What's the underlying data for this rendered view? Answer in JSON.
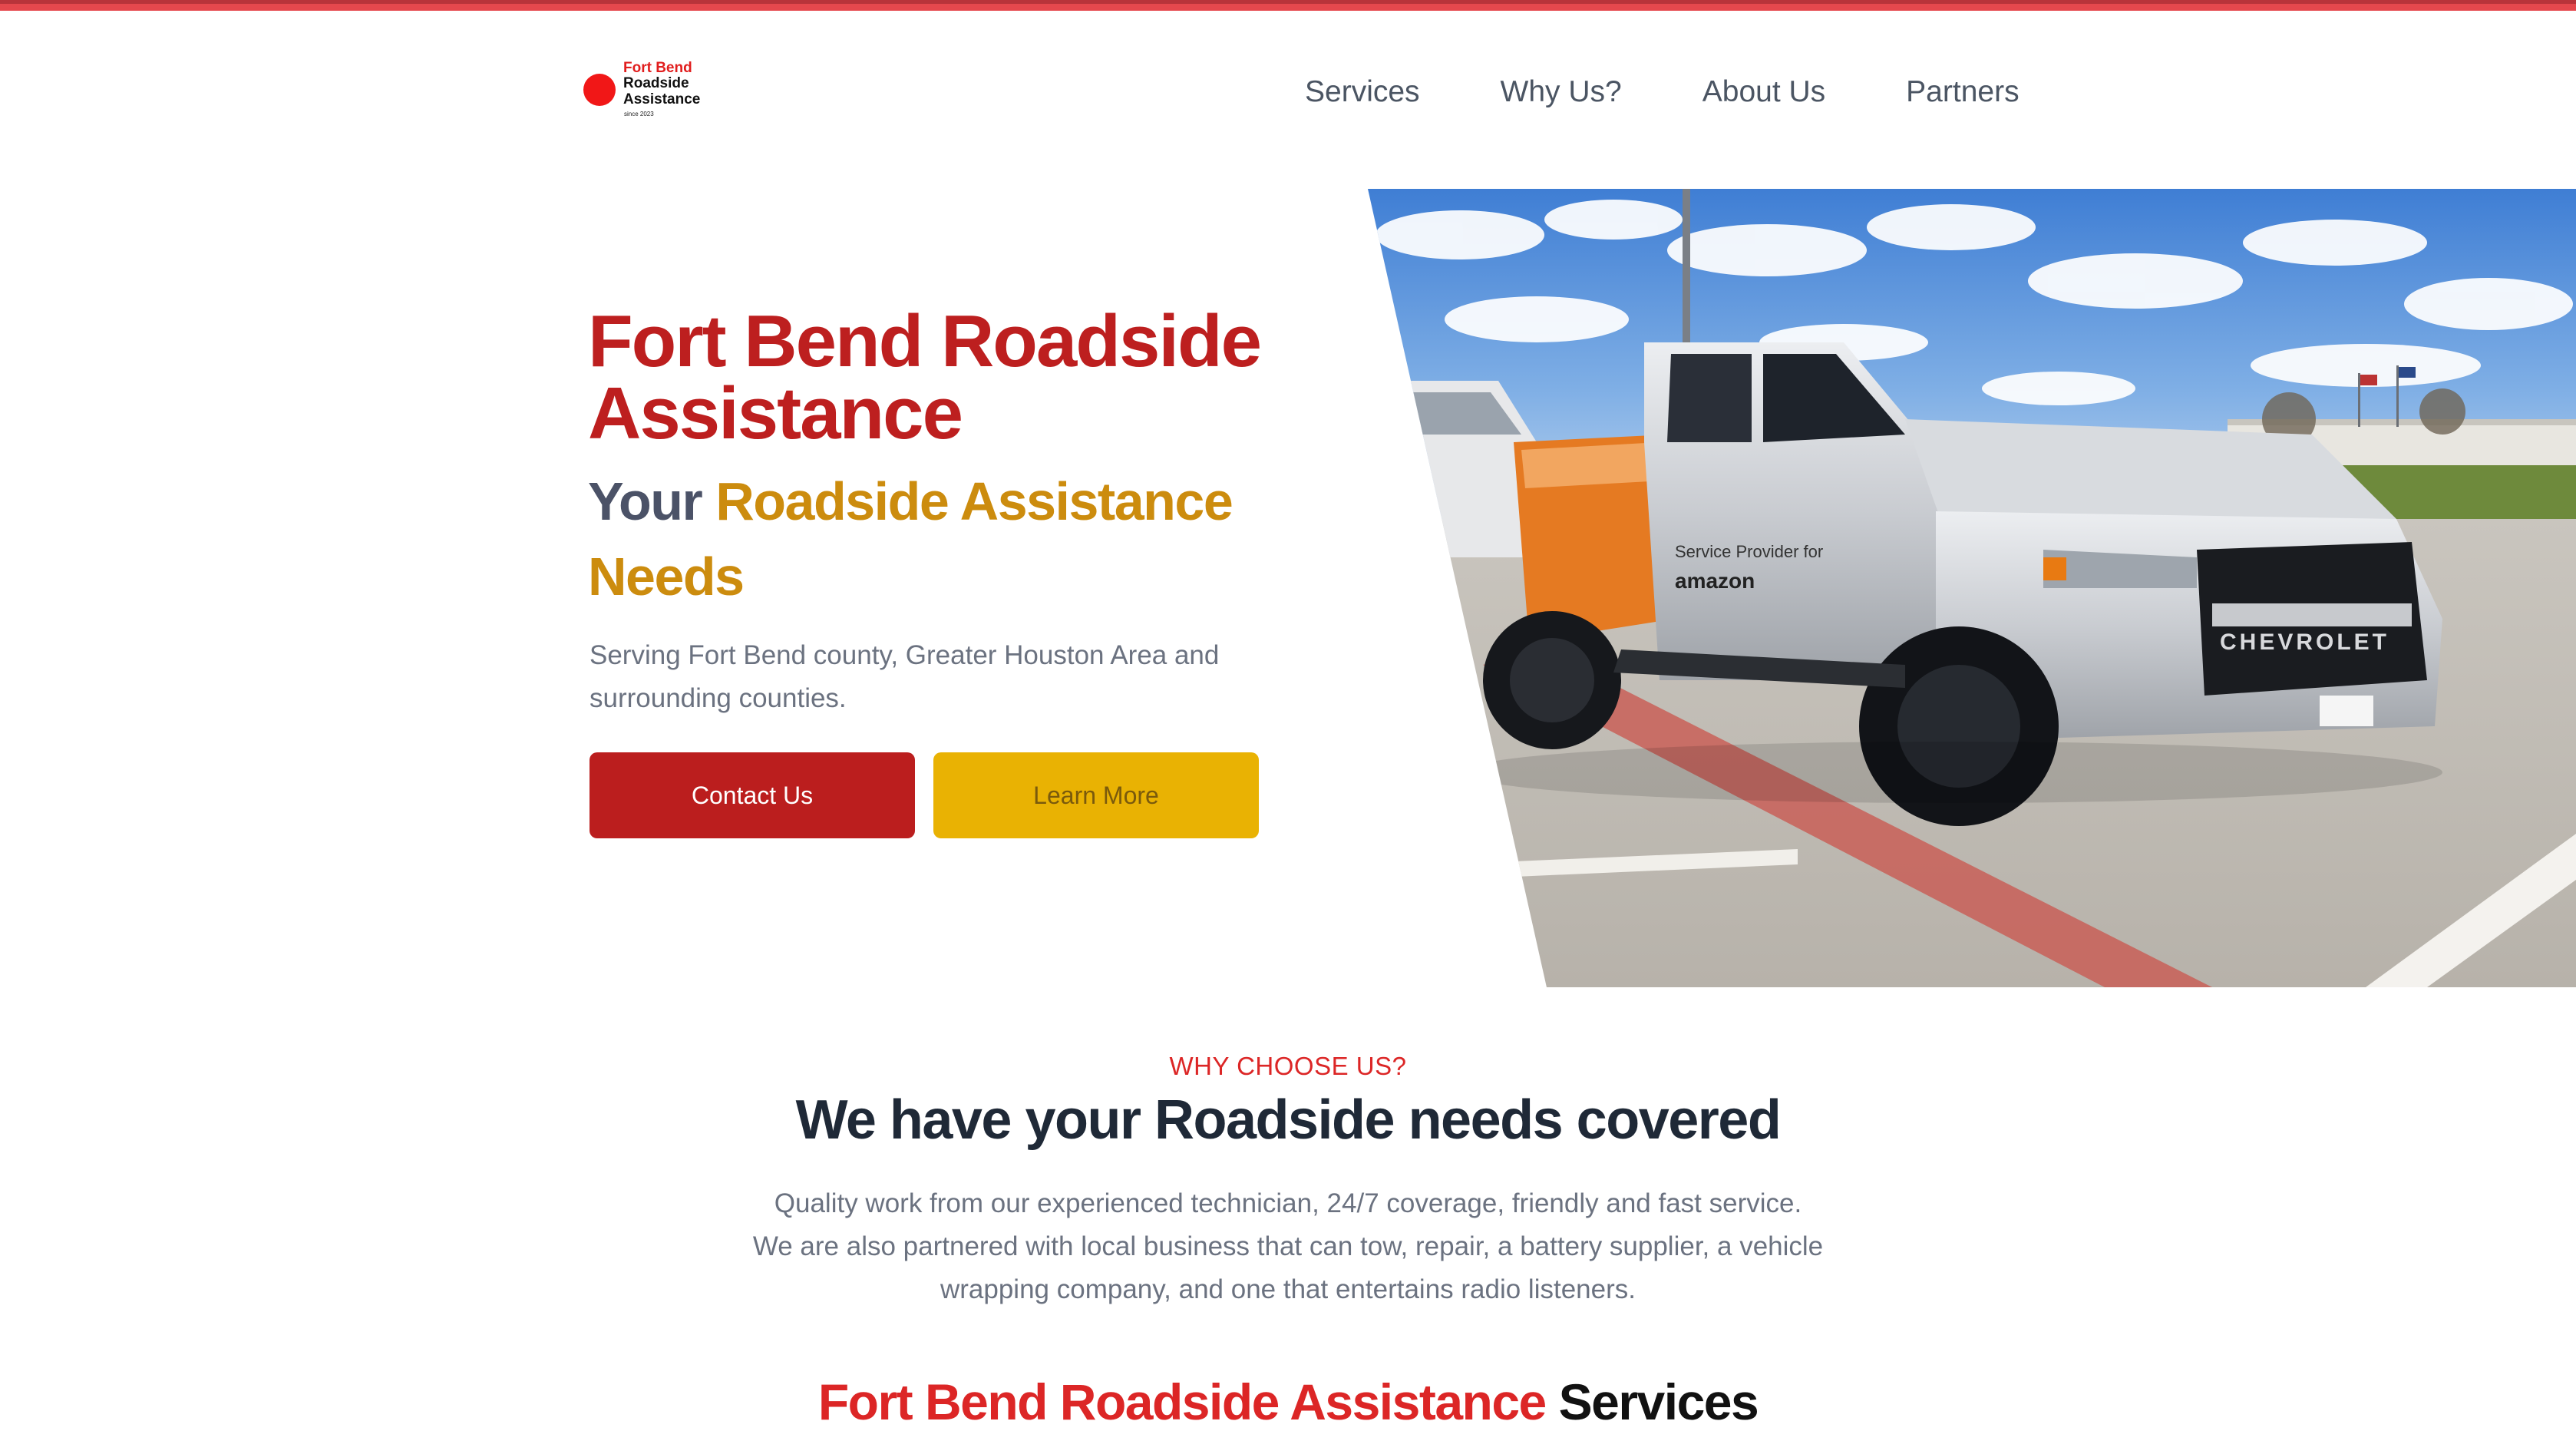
{
  "brand": {
    "logo_line1": "Fort Bend",
    "logo_line2": "Roadside",
    "logo_line3": "Assistance",
    "logo_line4": "since 2023",
    "accent_red": "#bd1f1f",
    "accent_gold": "#cc8c0e",
    "button_yellow": "#e9b203"
  },
  "nav": {
    "items": [
      {
        "label": "Services"
      },
      {
        "label": "Why Us?"
      },
      {
        "label": "About Us"
      },
      {
        "label": "Partners"
      }
    ]
  },
  "hero": {
    "title": "Fort Bend Roadside Assistance",
    "subtitle_part1": "Your",
    "subtitle_part2": "Roadside Assistance Needs",
    "description": "Serving Fort Bend county, Greater Houston Area and surrounding counties.",
    "contact_button": "Contact Us",
    "learn_button": "Learn More",
    "truck_brand": "CHEVROLET"
  },
  "why": {
    "eyebrow": "WHY CHOOSE US?",
    "title": "We have your Roadside needs covered",
    "description": "Quality work from our experienced technician, 24/7 coverage, friendly and fast service. We are also partnered with local business that can tow, repair, a battery supplier, a vehicle wrapping company, and one that entertains radio listeners."
  },
  "services": {
    "title_part1": "Fort Bend Roadside Assistance",
    "title_part2": "Services"
  }
}
